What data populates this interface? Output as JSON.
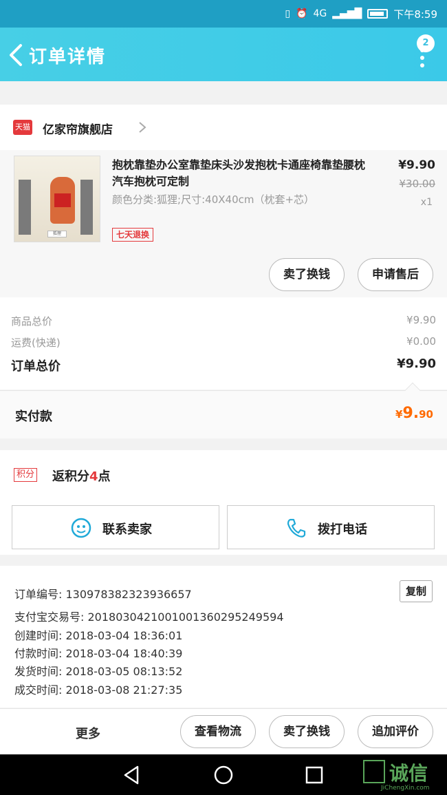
{
  "status": {
    "signal": "4G",
    "time": "下午8:59"
  },
  "header": {
    "title": "订单详情",
    "badge": "2"
  },
  "shop": {
    "logo_text": "天猫",
    "name": "亿家帘旗舰店"
  },
  "product": {
    "name": "抱枕靠垫办公室靠垫床头沙发抱枕卡通座椅靠垫腰枕汽车抱枕可定制",
    "spec": "颜色分类:狐狸;尺寸:40X40cm（枕套+芯）",
    "badge": "七天退换",
    "price": "¥9.90",
    "original_price": "¥30.00",
    "qty": "x1",
    "thumb_tag": "狐狸"
  },
  "actions": {
    "refund_exchange": "卖了换钱",
    "after_sale": "申请售后"
  },
  "summary": {
    "goods_label": "商品总价",
    "goods_value": "¥9.90",
    "shipping_label": "运费(快递)",
    "shipping_value": "¥0.00",
    "total_label": "订单总价",
    "total_value": "¥9.90"
  },
  "paid": {
    "label": "实付款",
    "currency": "¥",
    "amount_int": "9.",
    "amount_dec": "90"
  },
  "points": {
    "tag": "积分",
    "prefix": "返积分",
    "num": "4",
    "suffix": "点"
  },
  "contact": {
    "seller": "联系卖家",
    "phone": "拨打电话"
  },
  "order_info": {
    "order_no": "订单编号: 1309783823239366​57",
    "alipay_no": "支付宝交易号: 2018030421001001360295249594",
    "created": "创建时间: 2018-03-04 18:36:01",
    "paid_time": "付款时间: 2018-03-04 18:40:39",
    "shipped": "发货时间: 2018-03-05 08:13:52",
    "completed": "成交时间: 2018-03-08 21:27:35",
    "copy": "复制"
  },
  "bottom": {
    "more": "更多",
    "logistics": "查看物流",
    "sell": "卖了换钱",
    "review": "追加评价"
  },
  "watermark": {
    "big": "诚信",
    "small": "JiChengXin.com"
  }
}
